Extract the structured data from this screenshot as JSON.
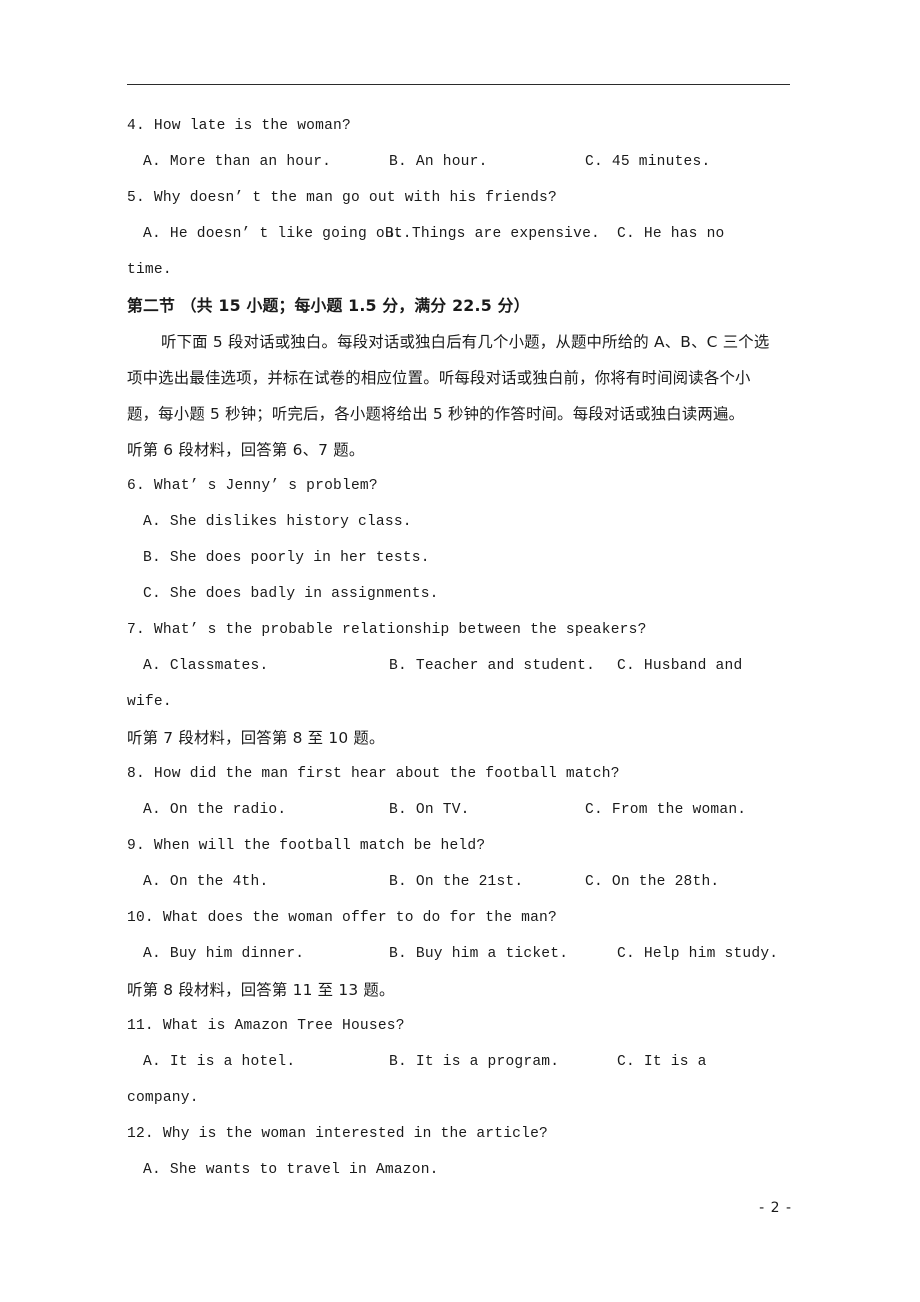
{
  "document": {
    "page_number": "- 2 -",
    "header_rule": true
  },
  "questions_part_one_tail": [
    {
      "number": "4.",
      "stem": "4. How late is the woman?",
      "options": [
        {
          "label": "A.",
          "text": "A. More than an hour."
        },
        {
          "label": "B.",
          "text": "B. An hour."
        },
        {
          "label": "C.",
          "text": "C. 45 minutes."
        }
      ]
    },
    {
      "number": "5.",
      "stem": "5. Why doesn’ t the man go out with his friends?",
      "options": [
        {
          "label": "A.",
          "text": "A. He doesn’ t like going out."
        },
        {
          "label": "B.",
          "text": "B. Things are expensive."
        },
        {
          "label": "C.",
          "text": "C. He has no"
        }
      ],
      "wrap": "time."
    }
  ],
  "section": {
    "heading": "第二节 （共 15 小题；每小题 1.5 分，满分 22.5 分）",
    "instructions": [
      "听下面 5 段对话或独白。每段对话或独白后有几个小题，从题中所给的 A、B、C 三个选",
      "项中选出最佳选项，并标在试卷的相应位置。听每段对话或独白前，你将有时间阅读各个小",
      "题，每小题 5 秒钟；听完后，各小题将给出 5 秒钟的作答时间。每段对话或独白读两遍。"
    ]
  },
  "materials": {
    "m6": "听第 6 段材料，回答第 6、7 题。",
    "m7": "听第 7 段材料，回答第 8 至 10 题。",
    "m8": "听第 8 段材料，回答第 11 至 13 题。"
  },
  "questions": [
    {
      "id": "q6",
      "stem": "6. What’ s Jenny’ s problem?",
      "options": [
        {
          "label": "A.",
          "text": "A. She dislikes history class."
        },
        {
          "label": "B.",
          "text": "B. She does poorly in her tests."
        },
        {
          "label": "C.",
          "text": "C. She does badly in assignments."
        }
      ],
      "layout": "stacked"
    },
    {
      "id": "q7",
      "stem": "7. What’ s the probable relationship between the speakers?",
      "options": [
        {
          "label": "A.",
          "text": "A. Classmates."
        },
        {
          "label": "B.",
          "text": "B. Teacher and student."
        },
        {
          "label": "C.",
          "text": "C.   Husband   and"
        }
      ],
      "wrap": "wife.",
      "layout": "inline"
    },
    {
      "id": "q8",
      "stem": "8. How did the man first hear about the football match?",
      "options": [
        {
          "label": "A.",
          "text": "A. On the radio."
        },
        {
          "label": "B.",
          "text": "B. On TV."
        },
        {
          "label": "C.",
          "text": "C. From the woman."
        }
      ],
      "layout": "inline"
    },
    {
      "id": "q9",
      "stem": "9. When will the football match be held?",
      "options": [
        {
          "label": "A.",
          "text": "A. On the 4th."
        },
        {
          "label": "B.",
          "text": "B. On the 21st."
        },
        {
          "label": "C.",
          "text": "C. On the 28th."
        }
      ],
      "layout": "inline"
    },
    {
      "id": "q10",
      "stem": "10. What does the woman offer to do for the man?",
      "options": [
        {
          "label": "A.",
          "text": "A. Buy him dinner."
        },
        {
          "label": "B.",
          "text": "B. Buy him a ticket."
        },
        {
          "label": "C.",
          "text": "C. Help him study."
        }
      ],
      "layout": "inline"
    },
    {
      "id": "q11",
      "stem": "11. What is Amazon Tree Houses?",
      "options": [
        {
          "label": "A.",
          "text": "A. It is a hotel."
        },
        {
          "label": "B.",
          "text": "B. It is a program."
        },
        {
          "label": "C.",
          "text": "C. It is a"
        }
      ],
      "wrap": "company.",
      "layout": "inline"
    },
    {
      "id": "q12",
      "stem": "12. Why is the woman interested in the article?",
      "options": [
        {
          "label": "A.",
          "text": "A. She wants to travel in Amazon."
        }
      ],
      "layout": "stacked"
    }
  ]
}
